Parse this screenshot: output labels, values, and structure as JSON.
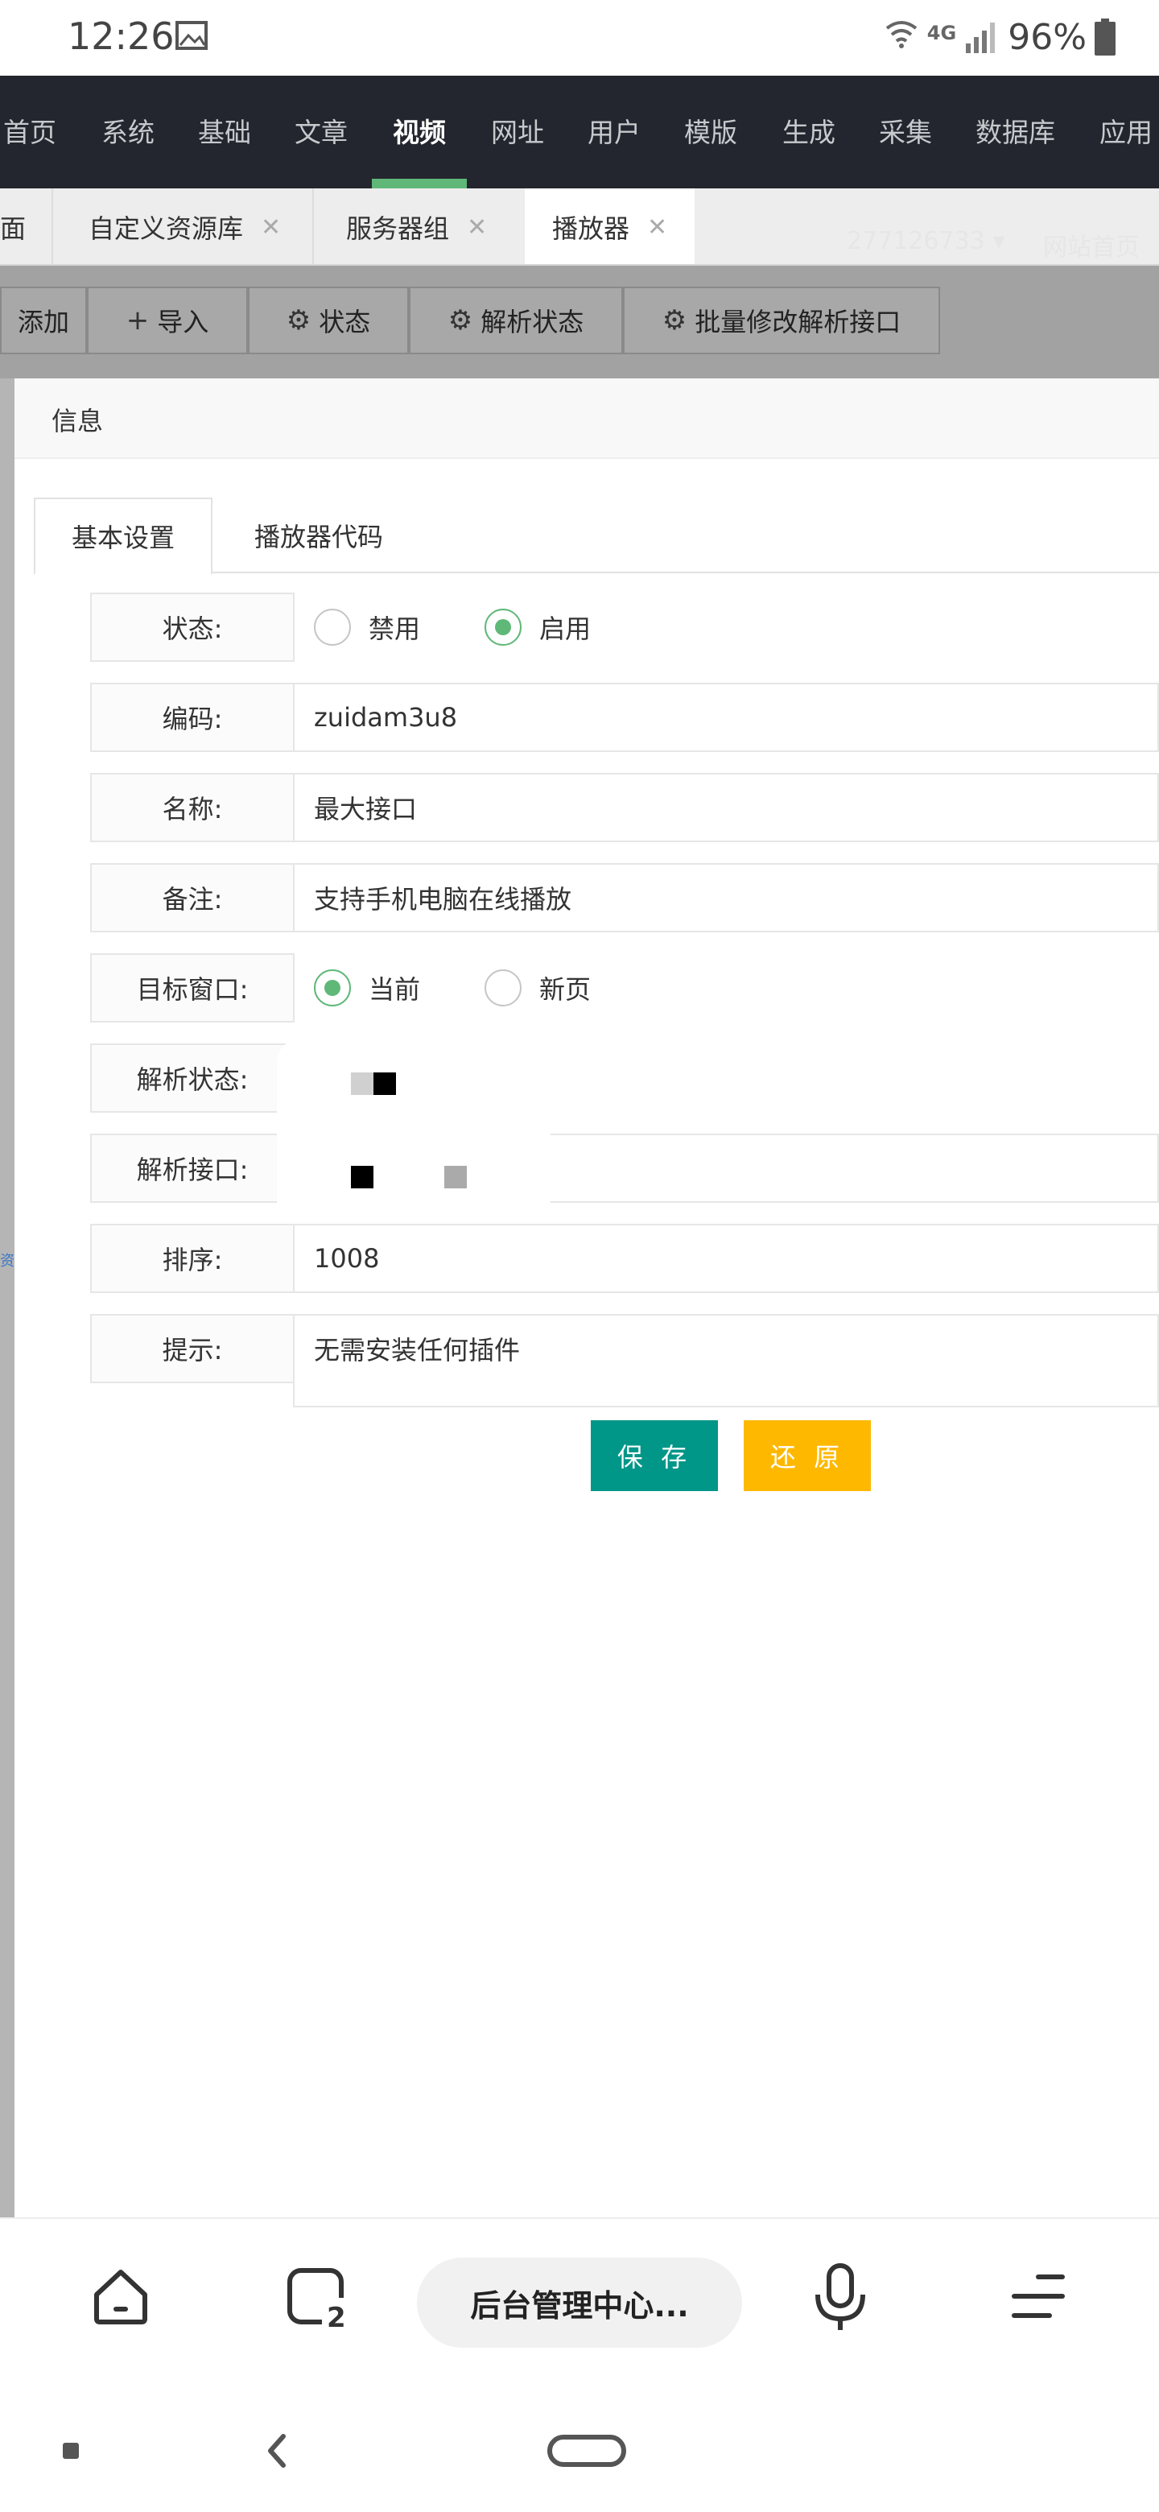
{
  "status_bar": {
    "time": "12:26",
    "network": "4G",
    "battery": "96%"
  },
  "nav": {
    "items": [
      "首页",
      "系统",
      "基础",
      "文章",
      "视频",
      "网址",
      "用户",
      "模版",
      "生成",
      "采集",
      "数据库",
      "应用"
    ],
    "active_index": 4
  },
  "tabs": [
    {
      "label": "面"
    },
    {
      "label": "自定义资源库"
    },
    {
      "label": "服务器组"
    },
    {
      "label": "播放器"
    }
  ],
  "top_right": {
    "user": "277126733",
    "home_link": "网站首页"
  },
  "toolbar": {
    "add": "添加",
    "import": "导入",
    "status": "状态",
    "parse_status": "解析状态",
    "batch_edit": "批量修改解析接口"
  },
  "side_link": "资源社区",
  "modal": {
    "title": "信息",
    "tabs": [
      "基本设置",
      "播放器代码"
    ],
    "fields": {
      "status_label": "状态:",
      "status_options": [
        "禁用",
        "启用"
      ],
      "code_label": "编码:",
      "code_value": "zuidam3u8",
      "name_label": "名称:",
      "name_value": "最大接口",
      "remark_label": "备注:",
      "remark_value": "支持手机电脑在线播放",
      "target_label": "目标窗口:",
      "target_options": [
        "当前",
        "新页"
      ],
      "parse_status_label": "解析状态:",
      "parse_api_label": "解析接口:",
      "sort_label": "排序:",
      "sort_value": "1008",
      "tip_label": "提示:",
      "tip_value": "无需安装任何插件"
    },
    "buttons": {
      "save": "保 存",
      "reset": "还 原"
    }
  },
  "browser": {
    "url_title": "后台管理中心..."
  },
  "colors": {
    "nav_bg": "#23262e",
    "nav_active": "#5fb878",
    "save": "#009688",
    "reset": "#ffb800",
    "radio_on": "#5fb878"
  }
}
